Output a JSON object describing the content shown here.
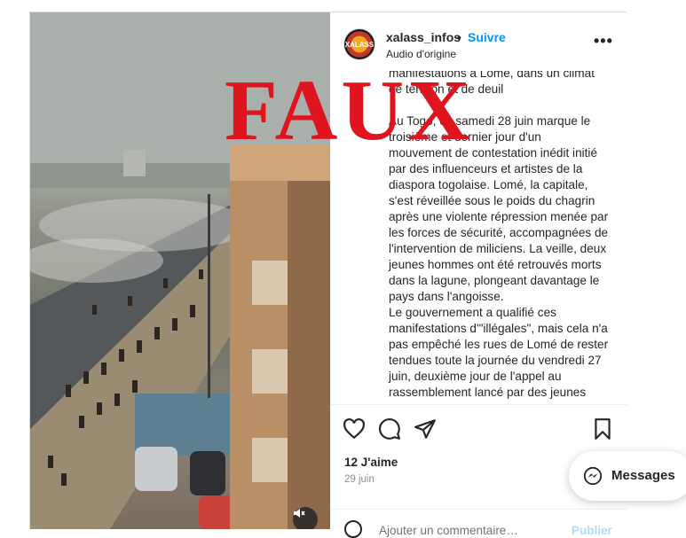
{
  "post": {
    "username": "xalass_infos",
    "separator": "•",
    "follow_label": "Suivre",
    "audio": "Audio d'origine",
    "avatar_text": "XALASS",
    "more_label": "•••",
    "caption_top": "manifestations à Lomé, dans un climat\nde tension et de deuil",
    "caption_p1": "Au Togo, ce samedi 28 juin marque le\ntroisième et dernier jour d'un\nmouvement de contestation inédit initié\npar des influenceurs et artistes de la\ndiaspora togolaise. Lomé, la capitale,\ns'est réveillée sous le poids du chagrin\naprès une violente répression menée par\nles forces de sécurité, accompagnées de\nl'intervention de miliciens. La veille, deux\njeunes hommes ont été retrouvés morts\ndans la lagune, plongeant davantage le\npays dans l'angoisse.",
    "caption_p2": "Le gouvernement a qualifié ces\nmanifestations d'\"illégales\", mais cela n'a\npas empêché les rues de Lomé de rester\ntendues toute la journée du vendredi 27\njuin, deuxième jour de l'appel au\nrassemblement lancé par des jeunes",
    "likes": "12 J'aime",
    "date": "29 juin",
    "comment_placeholder": "Ajouter un commentaire…",
    "publish_label": "Publier"
  },
  "overlay": {
    "stamp_text": "FAUX",
    "stamp_color": "#e0141e"
  },
  "messages": {
    "label": "Messages"
  },
  "icons": {
    "like": "heart-icon",
    "comment": "comment-icon",
    "share": "send-icon",
    "save": "bookmark-icon",
    "mute": "speaker-muted-icon",
    "emoji": "emoji-icon",
    "messenger": "messenger-icon"
  },
  "colors": {
    "link_blue": "#0095f6",
    "publish_disabled": "#b3dbff",
    "text": "#262626",
    "muted": "#8e8e8e"
  }
}
